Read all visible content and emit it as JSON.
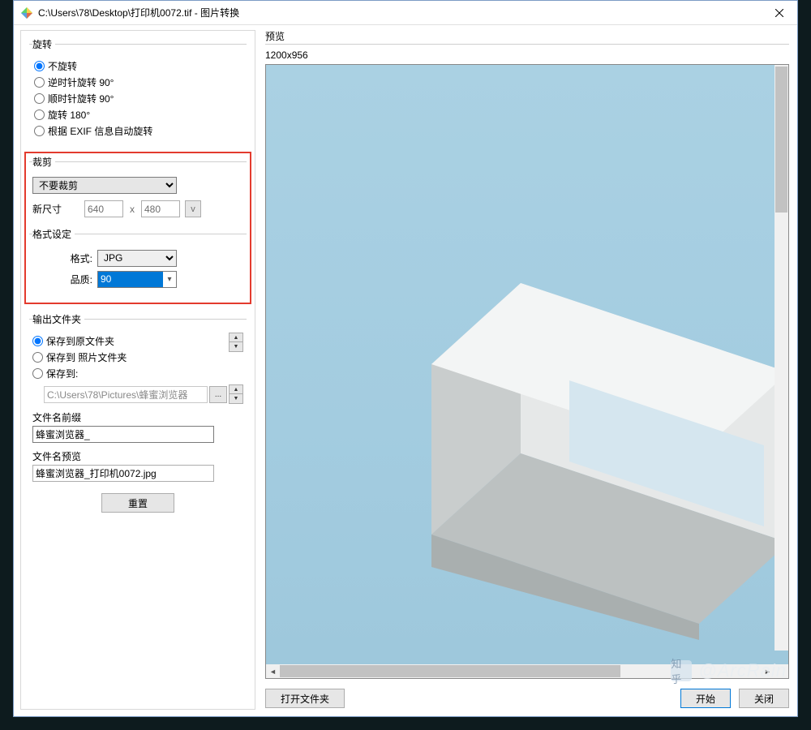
{
  "titlebar": {
    "path": "C:\\Users\\78\\Desktop\\打印机0072.tif - 图片转换"
  },
  "rotation": {
    "legend": "旋转",
    "options": [
      "不旋转",
      "逆时针旋转 90°",
      "顺时针旋转 90°",
      "旋转 180°",
      "根据 EXIF 信息自动旋转"
    ],
    "selected": 0
  },
  "crop": {
    "legend": "裁剪",
    "mode": "不要裁剪",
    "new_size_label": "新尺寸",
    "width": "640",
    "height": "480",
    "x": "x",
    "v": "v"
  },
  "format": {
    "legend": "格式设定",
    "format_label": "格式:",
    "format_value": "JPG",
    "quality_label": "品质:",
    "quality_value": "90"
  },
  "output": {
    "legend": "输出文件夹",
    "opts": [
      "保存到原文件夹",
      "保存到 照片文件夹",
      "保存到:"
    ],
    "selected": 0,
    "path": "C:\\Users\\78\\Pictures\\蜂蜜浏览器",
    "browse": "...",
    "up": "▲",
    "down": "▼",
    "prefix_label": "文件名前缀",
    "prefix_value": "蜂蜜浏览器_",
    "preview_label": "文件名预览",
    "preview_value": "蜂蜜浏览器_打印机0072.jpg",
    "reset": "重置"
  },
  "preview": {
    "label": "预览",
    "dims": "1200x956"
  },
  "buttons": {
    "open_folder": "打开文件夹",
    "start": "开始",
    "close": "关闭"
  },
  "watermark": {
    "brand": "知乎",
    "handle": "@ArcRain"
  }
}
